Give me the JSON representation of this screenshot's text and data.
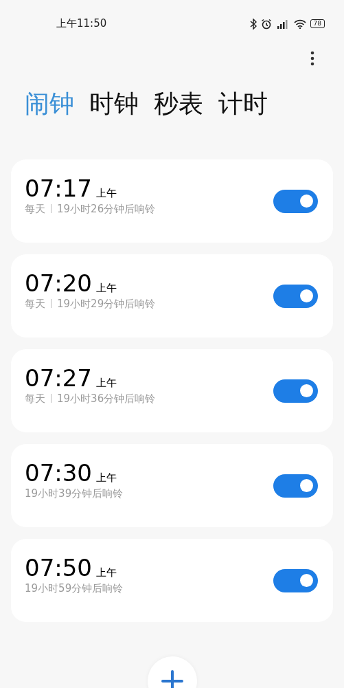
{
  "status_bar": {
    "time": "上午11:50",
    "battery": "78"
  },
  "tabs": [
    {
      "label": "闹钟",
      "selected": true
    },
    {
      "label": "时钟",
      "selected": false
    },
    {
      "label": "秒表",
      "selected": false
    },
    {
      "label": "计时",
      "selected": false
    }
  ],
  "alarms": [
    {
      "time": "07:17",
      "period": "上午",
      "repeat": "每天",
      "countdown": "19小时26分钟后响铃",
      "on": true
    },
    {
      "time": "07:20",
      "period": "上午",
      "repeat": "每天",
      "countdown": "19小时29分钟后响铃",
      "on": true
    },
    {
      "time": "07:27",
      "period": "上午",
      "repeat": "每天",
      "countdown": "19小时36分钟后响铃",
      "on": true
    },
    {
      "time": "07:30",
      "period": "上午",
      "countdown": "19小时39分钟后响铃",
      "on": true
    },
    {
      "time": "07:50",
      "period": "上午",
      "countdown": "19小时59分钟后响铃",
      "on": true
    }
  ]
}
